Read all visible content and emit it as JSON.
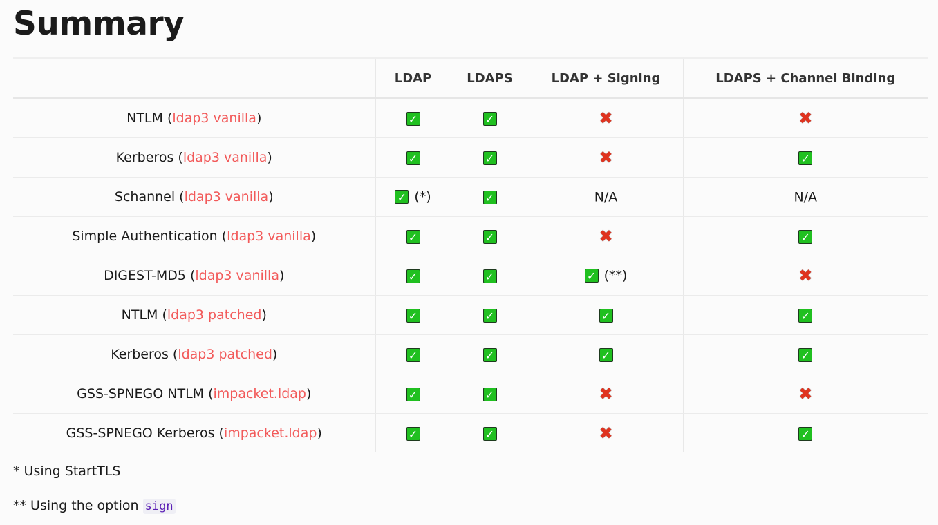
{
  "title": "Summary",
  "table": {
    "headers": [
      "",
      "LDAP",
      "LDAPS",
      "LDAP + Signing",
      "LDAPS + Channel Binding"
    ],
    "rows": [
      {
        "method": "NTLM",
        "lib": "ldap3 vanilla",
        "cells": [
          {
            "s": "ok"
          },
          {
            "s": "ok"
          },
          {
            "s": "no"
          },
          {
            "s": "no"
          }
        ]
      },
      {
        "method": "Kerberos",
        "lib": "ldap3 vanilla",
        "cells": [
          {
            "s": "ok"
          },
          {
            "s": "ok"
          },
          {
            "s": "no"
          },
          {
            "s": "ok"
          }
        ]
      },
      {
        "method": "Schannel",
        "lib": "ldap3 vanilla",
        "cells": [
          {
            "s": "ok",
            "note": "(*)"
          },
          {
            "s": "ok"
          },
          {
            "s": "na",
            "text": "N/A"
          },
          {
            "s": "na",
            "text": "N/A"
          }
        ]
      },
      {
        "method": "Simple Authentication",
        "lib": "ldap3 vanilla",
        "cells": [
          {
            "s": "ok"
          },
          {
            "s": "ok"
          },
          {
            "s": "no"
          },
          {
            "s": "ok"
          }
        ]
      },
      {
        "method": "DIGEST-MD5",
        "lib": "ldap3 vanilla",
        "cells": [
          {
            "s": "ok"
          },
          {
            "s": "ok"
          },
          {
            "s": "ok",
            "note": "(**)"
          },
          {
            "s": "no"
          }
        ]
      },
      {
        "method": "NTLM",
        "lib": "ldap3 patched",
        "cells": [
          {
            "s": "ok"
          },
          {
            "s": "ok"
          },
          {
            "s": "ok"
          },
          {
            "s": "ok"
          }
        ]
      },
      {
        "method": "Kerberos",
        "lib": "ldap3 patched",
        "cells": [
          {
            "s": "ok"
          },
          {
            "s": "ok"
          },
          {
            "s": "ok"
          },
          {
            "s": "ok"
          }
        ]
      },
      {
        "method": "GSS-SPNEGO NTLM",
        "lib": "impacket.ldap",
        "cells": [
          {
            "s": "ok"
          },
          {
            "s": "ok"
          },
          {
            "s": "no"
          },
          {
            "s": "no"
          }
        ]
      },
      {
        "method": "GSS-SPNEGO Kerberos",
        "lib": "impacket.ldap",
        "cells": [
          {
            "s": "ok"
          },
          {
            "s": "ok"
          },
          {
            "s": "no"
          },
          {
            "s": "ok"
          }
        ]
      }
    ]
  },
  "footnotes": {
    "note1": "* Using StartTLS",
    "note2_prefix": "** Using the option ",
    "note2_code": "sign"
  },
  "colors": {
    "check": "#20c020",
    "cross": "#e0331f",
    "lib_link": "#f25a5a",
    "code": "#5b1fb5"
  },
  "icons": {
    "ok": "check-mark-button-icon",
    "no": "cross-mark-icon"
  }
}
